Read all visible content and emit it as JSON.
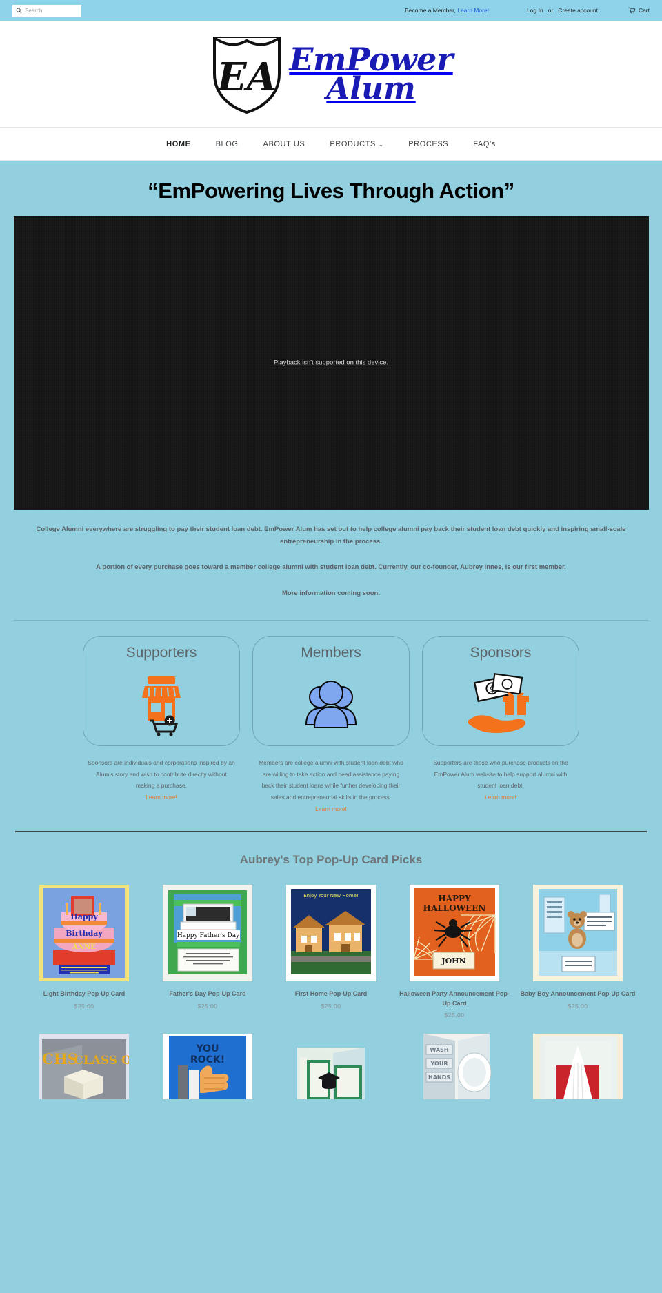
{
  "colors": {
    "page_bg": "#92cfdf",
    "topbar_bg": "#8fd3ea",
    "accent_orange": "#e8762b",
    "logo_blue": "#1a1ab5",
    "link_blue": "#1e5ad6",
    "text_gray": "#5f676c"
  },
  "topbar": {
    "search_placeholder": "Search",
    "search_value": "",
    "search_icon": "search-icon",
    "member_prefix": "Become a Member,",
    "member_link": "Learn More!",
    "login_label": "Log In",
    "or_label": "or",
    "create_account_label": "Create account",
    "cart_icon": "shopping-cart-icon",
    "cart_label": "Cart"
  },
  "logo": {
    "shield_monogram": "EA",
    "line1": "EmPower",
    "line2": "Alum"
  },
  "nav": {
    "items": [
      {
        "label": "HOME",
        "active": true,
        "has_dropdown": false
      },
      {
        "label": "BLOG",
        "active": false,
        "has_dropdown": false
      },
      {
        "label": "ABOUT US",
        "active": false,
        "has_dropdown": false
      },
      {
        "label": "PRODUCTS",
        "active": false,
        "has_dropdown": true
      },
      {
        "label": "PROCESS",
        "active": false,
        "has_dropdown": false
      },
      {
        "label": "FAQ's",
        "active": false,
        "has_dropdown": false
      }
    ],
    "dropdown_glyph": "⌄"
  },
  "hero": {
    "title": "“EmPowering Lives Through Action”",
    "video_message": "Playback isn't supported on this device."
  },
  "intro": {
    "paragraph1": "College Alumni everywhere are struggling to pay their student loan debt. EmPower Alum has set out to help college alumni pay back their student loan debt quickly and inspiring small-scale entrepreneurship in the process.",
    "paragraph2": "A portion of every purchase goes toward a member college alumni with student loan debt. Currently, our co-founder, Aubrey Innes, is our first member.",
    "paragraph3": "More information coming soon."
  },
  "roles": [
    {
      "title": "Supporters",
      "icon": "storefront-add-to-cart-icon",
      "description": "Sponsors are individuals and corporations inspired by an Alum's story and wish to contribute directly without making a purchase.",
      "link_label": "Learn more!"
    },
    {
      "title": "Members",
      "icon": "group-of-people-icon",
      "description": "Members are college alumni with student loan debt who are willing to take action and need assistance paying back their student loans while further developing their sales and entrepreneurial skills in the process.",
      "link_label": "Learn more!"
    },
    {
      "title": "Sponsors",
      "icon": "money-gift-hand-icon",
      "description": "Supporters are those who purchase products on the EmPower Alum website to help support alumni with student loan debt.",
      "link_label": "Learn more!"
    }
  ],
  "products_section": {
    "heading": "Aubrey's Top Pop-Up Card Picks",
    "row1": [
      {
        "name": "Light Birthday Pop-Up Card",
        "price": "$25.00",
        "thumb": "birthday-cake-popup-card"
      },
      {
        "name": "Father's Day Pop-Up Card",
        "price": "$25.00",
        "thumb": "fathers-day-laptop-popup-card"
      },
      {
        "name": "First Home Pop-Up Card",
        "price": "$25.00",
        "thumb": "first-home-house-popup-card"
      },
      {
        "name": "Halloween Party Announcement Pop-Up Card",
        "price": "$25.00",
        "thumb": "halloween-spider-web-popup-card"
      },
      {
        "name": "Baby Boy Announcement Pop-Up Card",
        "price": "$25.00",
        "thumb": "baby-boy-bear-popup-card"
      }
    ],
    "row2": [
      {
        "thumb": "chs-class-of-graduation-popup-card",
        "caption": "CHS CLASS OF"
      },
      {
        "thumb": "you-rock-thumbs-up-popup-card",
        "caption": "YOU ROCK!"
      },
      {
        "thumb": "graduation-cap-popup-card",
        "caption": ""
      },
      {
        "thumb": "wash-your-hands-popup-card",
        "caption": ""
      },
      {
        "thumb": "wedding-dress-popup-card",
        "caption": ""
      }
    ]
  }
}
